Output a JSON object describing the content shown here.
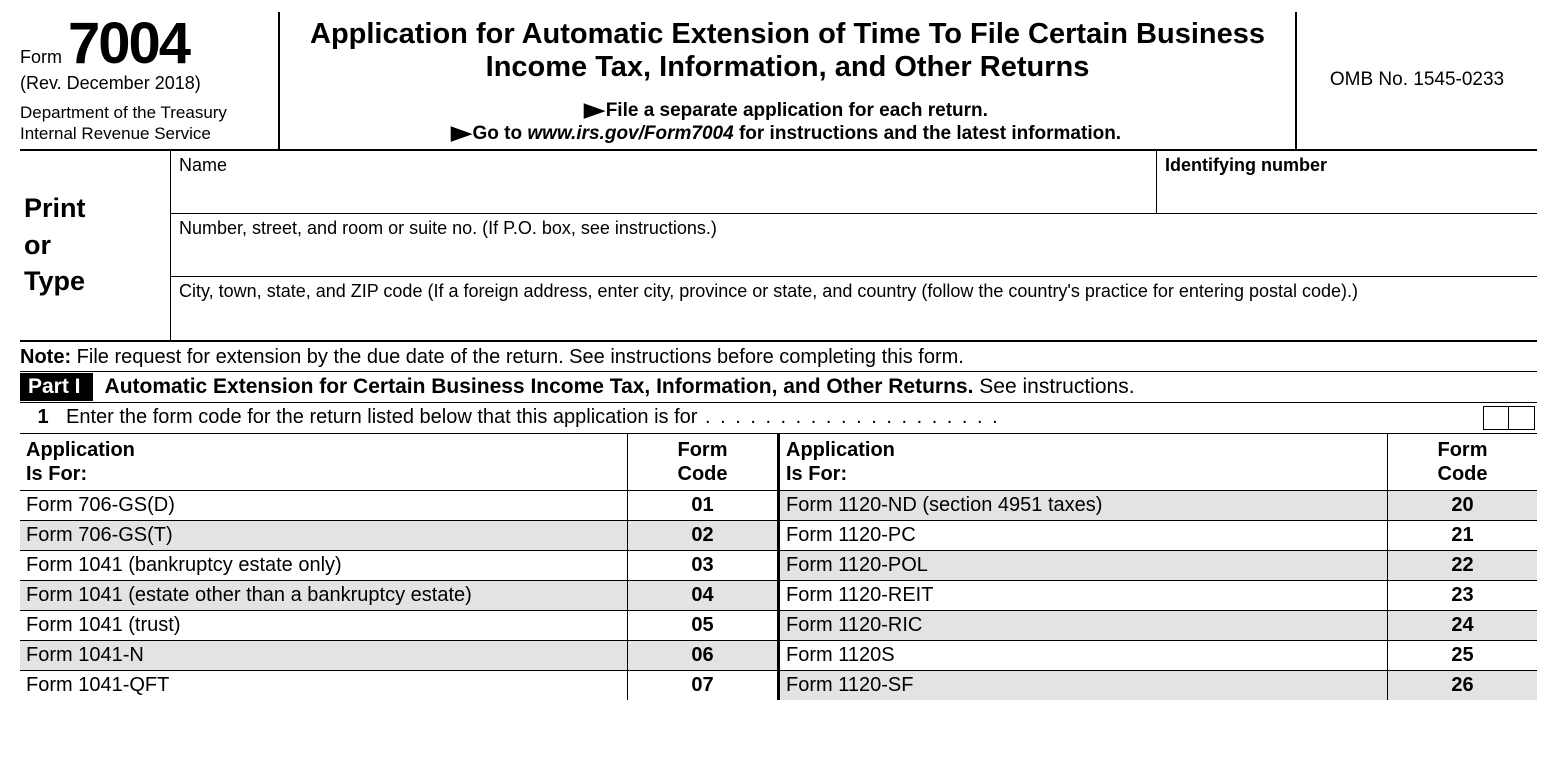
{
  "header": {
    "form_label": "Form",
    "form_number": "7004",
    "rev_date": "(Rev. December 2018)",
    "dept1": "Department of the Treasury",
    "dept2": "Internal Revenue Service",
    "title": "Application for Automatic Extension of Time To File Certain Business Income Tax, Information, and Other Returns",
    "sub1_pre": "File a separate application for each return.",
    "sub2_pre": "Go to ",
    "sub2_link": "www.irs.gov/Form7004",
    "sub2_post": " for instructions and the latest information.",
    "omb": "OMB No. 1545-0233"
  },
  "identity": {
    "print_or_type_1": "Print",
    "print_or_type_2": "or",
    "print_or_type_3": "Type",
    "name_label": "Name",
    "idnum_label": "Identifying number",
    "address_label": "Number, street, and room or suite no. (If P.O. box, see instructions.)",
    "city_label": "City, town, state, and ZIP code (If a foreign address, enter city, province or state, and country (follow the country's practice for entering postal code).)"
  },
  "note": {
    "note_bold": "Note:",
    "note_text": " File request for extension by the due date of the return. See instructions before completing this form."
  },
  "part1": {
    "badge": "Part I",
    "title_bold": "Automatic Extension for Certain Business Income Tax, Information, and Other Returns.",
    "title_rest": " See instructions."
  },
  "line1": {
    "num": "1",
    "text": "Enter the form code for the return listed below that this application is for"
  },
  "table": {
    "header_app": "Application\nIs For:",
    "header_code": "Form\nCode",
    "left_rows": [
      {
        "app": "Form 706-GS(D)",
        "code": "01",
        "shaded": false
      },
      {
        "app": "Form 706-GS(T)",
        "code": "02",
        "shaded": true
      },
      {
        "app": "Form 1041 (bankruptcy estate only)",
        "code": "03",
        "shaded": false
      },
      {
        "app": "Form 1041 (estate other than a bankruptcy estate)",
        "code": "04",
        "shaded": true
      },
      {
        "app": "Form 1041 (trust)",
        "code": "05",
        "shaded": false
      },
      {
        "app": "Form 1041-N",
        "code": "06",
        "shaded": true
      },
      {
        "app": "Form 1041-QFT",
        "code": "07",
        "shaded": false
      }
    ],
    "right_rows": [
      {
        "app": "Form 1120-ND (section 4951 taxes)",
        "code": "20",
        "shaded": true
      },
      {
        "app": "Form 1120-PC",
        "code": "21",
        "shaded": false
      },
      {
        "app": "Form 1120-POL",
        "code": "22",
        "shaded": true
      },
      {
        "app": "Form 1120-REIT",
        "code": "23",
        "shaded": false
      },
      {
        "app": "Form 1120-RIC",
        "code": "24",
        "shaded": true
      },
      {
        "app": "Form 1120S",
        "code": "25",
        "shaded": false
      },
      {
        "app": "Form 1120-SF",
        "code": "26",
        "shaded": true
      }
    ]
  }
}
